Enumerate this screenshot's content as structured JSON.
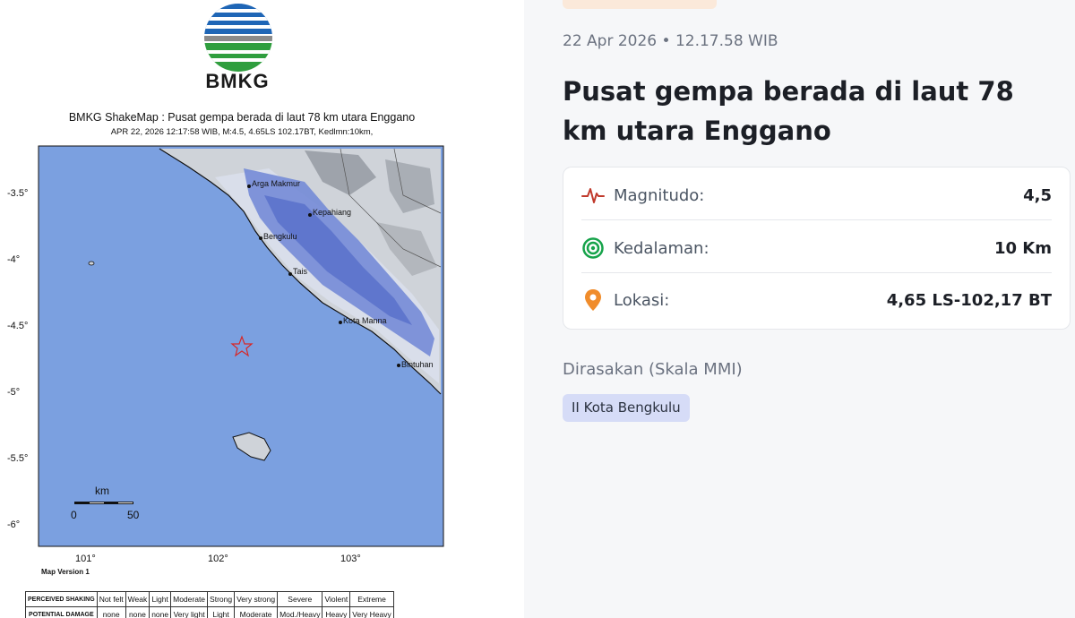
{
  "shakemap": {
    "logo_text": "BMKG",
    "title": "BMKG ShakeMap : Pusat gempa berada di laut 78 km utara Enggano",
    "subtitle": "APR 22, 2026 12:17:58 WIB, M:4.5, 4.65LS 102.17BT, Kedlmn:10km,",
    "version": "Map Version 1",
    "y_ticks": [
      "-3.5°",
      "-4°",
      "-4.5°",
      "-5°",
      "-5.5°",
      "-6°"
    ],
    "x_ticks": [
      "101°",
      "102°",
      "103°"
    ],
    "cities": [
      "Arga Makmur",
      "Kepahiang",
      "Bengkulu",
      "Tais",
      "Kota Manna",
      "Bintuhan"
    ],
    "scale_unit": "km",
    "scale_min": "0",
    "scale_max": "50",
    "legend": {
      "row1_label": "PERCEIVED SHAKING",
      "row1": [
        "Not felt",
        "Weak",
        "Light",
        "Moderate",
        "Strong",
        "Very strong",
        "Severe",
        "Violent",
        "Extreme"
      ],
      "row2_label": "POTENTIAL DAMAGE",
      "row2": [
        "none",
        "none",
        "none",
        "Very light",
        "Light",
        "Moderate",
        "Mod./Heavy",
        "Heavy",
        "Very Heavy"
      ]
    }
  },
  "detail": {
    "date": "22 Apr 2026 • 12.17.58 WIB",
    "headline": "Pusat gempa berada di laut 78 km utara Enggano",
    "magnitude_label": "Magnitudo:",
    "magnitude_value": "4,5",
    "depth_label": "Kedalaman:",
    "depth_value": "10 Km",
    "location_label": "Lokasi:",
    "location_value": "4,65 LS-102,17 BT",
    "felt_title": "Dirasakan (Skala MMI)",
    "felt_chip": "II Kota Bengkulu"
  },
  "colors": {
    "sea": "#7ba0e0",
    "accent_magnitude": "#c0392b",
    "accent_depth": "#16a34a",
    "accent_location": "#f08c2b",
    "chip_bg": "#d6dcf7"
  }
}
